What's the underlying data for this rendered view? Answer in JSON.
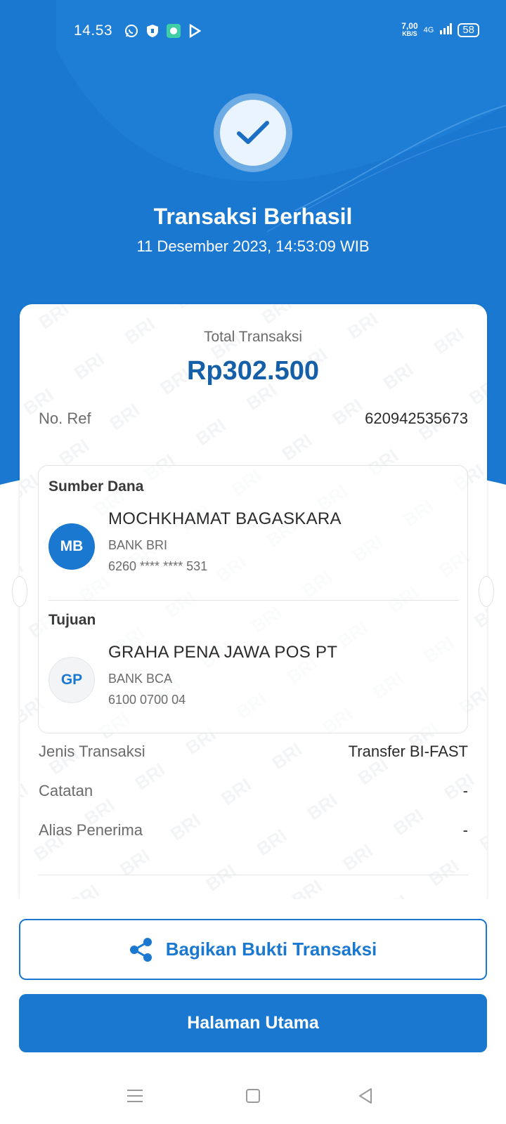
{
  "status_bar": {
    "time": "14.53",
    "net_speed_value": "7,00",
    "net_speed_unit": "KB/S",
    "network": "4G",
    "battery": "58",
    "icons": [
      "whatsapp-icon",
      "shield-icon",
      "chat-bubble-icon",
      "play-store-icon"
    ]
  },
  "header": {
    "title": "Transaksi Berhasil",
    "datetime": "11 Desember 2023, 14:53:09 WIB"
  },
  "summary": {
    "total_label": "Total Transaksi",
    "total_amount": "Rp302.500",
    "ref_label": "No. Ref",
    "ref_value": "620942535673"
  },
  "source": {
    "section_title": "Sumber Dana",
    "initials": "MB",
    "name": "MOCHKHAMAT BAGASKARA",
    "bank": "BANK BRI",
    "account": "6260 **** **** 531"
  },
  "destination": {
    "section_title": "Tujuan",
    "initials": "GP",
    "name": "GRAHA PENA JAWA POS PT",
    "bank": "BANK BCA",
    "account": "6100 0700 04"
  },
  "details": [
    {
      "label": "Jenis Transaksi",
      "value": "Transfer BI-FAST"
    },
    {
      "label": "Catatan",
      "value": "-"
    },
    {
      "label": "Alias Penerima",
      "value": "-"
    }
  ],
  "watermark_text": "BRI",
  "actions": {
    "share_label": "Bagikan Bukti Transaksi",
    "home_label": "Halaman Utama"
  },
  "colors": {
    "primary": "#1a78d1",
    "amount": "#155ea8"
  }
}
